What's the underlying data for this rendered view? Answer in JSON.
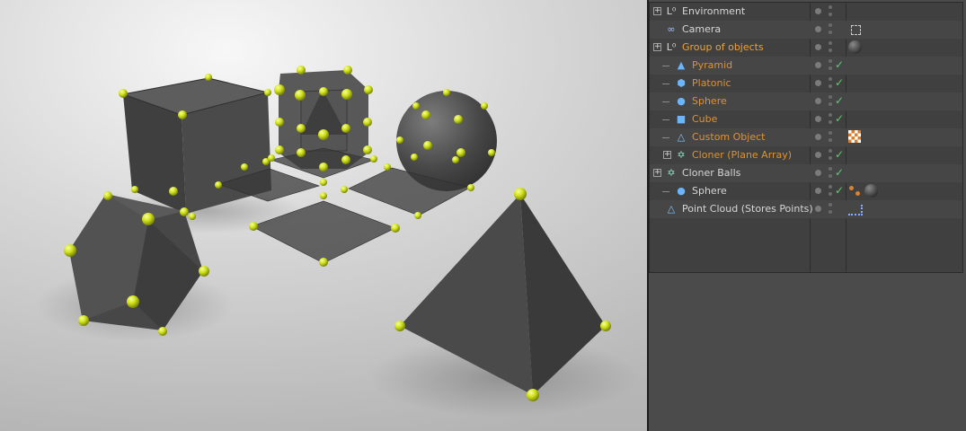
{
  "viewport": {
    "scene_objects": [
      "cube",
      "platonic",
      "sphere",
      "pyramid",
      "plane-array",
      "cloner-balls"
    ],
    "accent_color": "#c9de16"
  },
  "object_manager": {
    "rows": [
      {
        "id": "environment",
        "name": "Environment",
        "icon": "null-object-icon",
        "level": 0,
        "expand": true,
        "check": false,
        "tags": []
      },
      {
        "id": "camera",
        "name": "Camera",
        "icon": "camera-icon",
        "level": 0,
        "expand": false,
        "check": false,
        "tags": [
          "protection-tag-icon"
        ]
      },
      {
        "id": "group-of-objects",
        "name": "Group of objects",
        "icon": "null-object-icon",
        "level": 0,
        "expand": true,
        "check": false,
        "tags": [
          "material-tag-icon"
        ],
        "style": "selhead"
      },
      {
        "id": "pyramid",
        "name": "Pyramid",
        "icon": "pyramid-icon",
        "level": 1,
        "expand": false,
        "check": true,
        "tags": [],
        "style": "child"
      },
      {
        "id": "platonic",
        "name": "Platonic",
        "icon": "platonic-icon",
        "level": 1,
        "expand": false,
        "check": true,
        "tags": [],
        "style": "child"
      },
      {
        "id": "sphere",
        "name": "Sphere",
        "icon": "sphere-icon",
        "level": 1,
        "expand": false,
        "check": true,
        "tags": [],
        "style": "child"
      },
      {
        "id": "cube",
        "name": "Cube",
        "icon": "cube-icon",
        "level": 1,
        "expand": false,
        "check": true,
        "tags": [],
        "style": "child"
      },
      {
        "id": "custom-object",
        "name": "Custom Object",
        "icon": "polygon-object-icon",
        "level": 1,
        "expand": false,
        "check": false,
        "tags": [
          "checker-tag-icon"
        ],
        "style": "child"
      },
      {
        "id": "cloner-plane-array",
        "name": "Cloner (Plane Array)",
        "icon": "cloner-icon",
        "level": 1,
        "expand": true,
        "check": true,
        "tags": [],
        "style": "child"
      },
      {
        "id": "cloner-balls",
        "name": "Cloner Balls",
        "icon": "cloner-icon",
        "level": 0,
        "expand": true,
        "check": true,
        "tags": []
      },
      {
        "id": "sphere-2",
        "name": "Sphere",
        "icon": "sphere-icon",
        "level": 1,
        "expand": false,
        "check": true,
        "tags": [
          "mograph-tag-icon",
          "material-tag-icon"
        ]
      },
      {
        "id": "point-cloud",
        "name": "Point Cloud (Stores Points)",
        "icon": "polygon-object-icon",
        "level": 0,
        "expand": false,
        "check": false,
        "tags": [
          "points-tag-icon"
        ]
      }
    ]
  }
}
